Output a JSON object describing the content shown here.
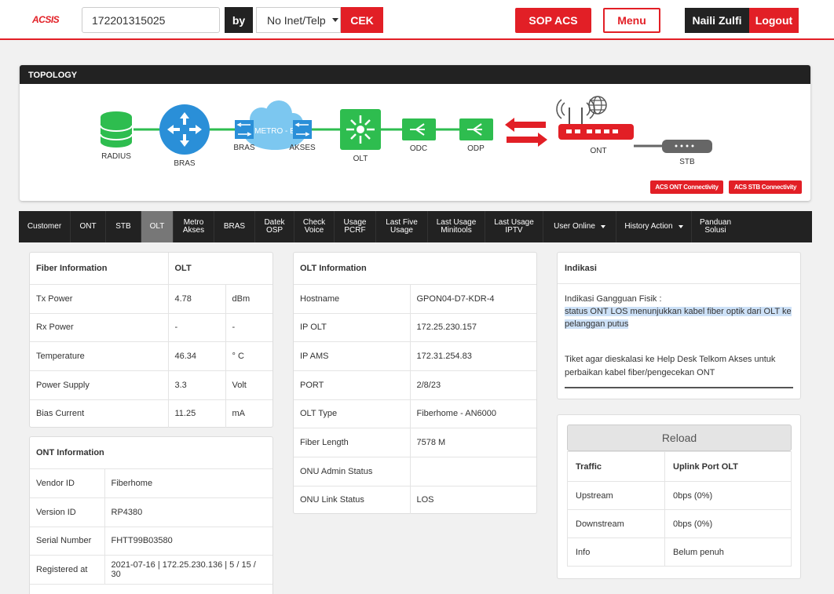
{
  "header": {
    "logo": "ACSIS",
    "search_value": "172201315025",
    "by_label": "by",
    "type_selected": "No Inet/Telp",
    "cek_label": "CEK",
    "sop_label": "SOP ACS",
    "menu_label": "Menu",
    "user_name": "Naili Zulfi",
    "logout_label": "Logout"
  },
  "topology": {
    "title": "TOPOLOGY",
    "nodes": {
      "radius": "RADIUS",
      "bras": "BRAS",
      "bras2": "BRAS",
      "metro": "METRO - E",
      "akses": "AKSES",
      "olt": "OLT",
      "odc": "ODC",
      "odp": "ODP",
      "ont": "ONT",
      "stb": "STB"
    },
    "ont_conn_label": "ACS ONT Connectivity",
    "stb_conn_label": "ACS STB Connectivity",
    "colors": {
      "green": "#2ebd4f",
      "blue": "#2a8fd8",
      "cloud": "#7cc7f0",
      "red": "#e21f26",
      "gray": "#666666"
    }
  },
  "tabs": [
    {
      "label": "Customer"
    },
    {
      "label": "ONT"
    },
    {
      "label": "STB"
    },
    {
      "label": "OLT",
      "active": true
    },
    {
      "label": "Metro\nAkses"
    },
    {
      "label": "BRAS"
    },
    {
      "label": "Datek\nOSP"
    },
    {
      "label": "Check\nVoice"
    },
    {
      "label": "Usage\nPCRF"
    },
    {
      "label": "Last Five\nUsage"
    },
    {
      "label": "Last Usage\nMinitools"
    },
    {
      "label": "Last Usage\nIPTV"
    },
    {
      "label": "User Online",
      "dropdown": true
    },
    {
      "label": "History Action",
      "dropdown": true
    },
    {
      "label": "Panduan\nSolusi"
    }
  ],
  "fiber": {
    "h1": "Fiber Information",
    "h2": "OLT",
    "rows": [
      {
        "label": "Tx Power",
        "value": "4.78",
        "unit": "dBm"
      },
      {
        "label": "Rx Power",
        "value": "-",
        "unit": "-"
      },
      {
        "label": "Temperature",
        "value": "46.34",
        "unit": "° C"
      },
      {
        "label": "Power Supply",
        "value": "3.3",
        "unit": "Volt"
      },
      {
        "label": "Bias Current",
        "value": "11.25",
        "unit": "mA"
      }
    ]
  },
  "ont": {
    "title": "ONT Information",
    "rows": [
      {
        "label": "Vendor ID",
        "value": "Fiberhome"
      },
      {
        "label": "Version ID",
        "value": "RP4380"
      },
      {
        "label": "Serial Number",
        "value": "FHTT99B03580"
      },
      {
        "label": "Registered at",
        "value": "2021-07-16 | 172.25.230.136 | 5 / 15 / 30"
      }
    ]
  },
  "olt": {
    "title": "OLT Information",
    "rows": [
      {
        "label": "Hostname",
        "value": "GPON04-D7-KDR-4"
      },
      {
        "label": "IP OLT",
        "value": "172.25.230.157"
      },
      {
        "label": "IP AMS",
        "value": "172.31.254.83"
      },
      {
        "label": "PORT",
        "value": "2/8/23"
      },
      {
        "label": "OLT Type",
        "value": "Fiberhome - AN6000"
      },
      {
        "label": "Fiber Length",
        "value": "7578 M"
      },
      {
        "label": "ONU Admin Status",
        "value": ""
      },
      {
        "label": "ONU Link Status",
        "value": "LOS"
      }
    ]
  },
  "indikasi": {
    "title": "Indikasi",
    "line1": "Indikasi Gangguan Fisik :",
    "highlight_a": "status ONT LOS menunjukkan kabel fiber optik dari OLT ke",
    "highlight_b": "pelanggan putus",
    "ticket_a": "Tiket agar dieskalasi ke Help Desk Telkom Akses untuk",
    "ticket_b": "perbaikan kabel fiber/pengecekan ONT"
  },
  "traffic": {
    "reload_label": "Reload",
    "h1": "Traffic",
    "h2": "Uplink Port OLT",
    "rows": [
      {
        "label": "Upstream",
        "value": "0bps (0%)"
      },
      {
        "label": "Downstream",
        "value": "0bps (0%)"
      },
      {
        "label": "Info",
        "value": "Belum penuh"
      }
    ]
  }
}
